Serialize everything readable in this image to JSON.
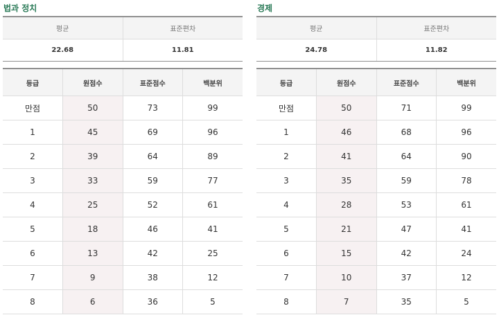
{
  "panels": [
    {
      "title": "법과 정치",
      "stats": {
        "mean_label": "평균",
        "sd_label": "표준편차",
        "mean": "22.68",
        "sd": "11.81"
      },
      "columns": [
        "등급",
        "원점수",
        "표준점수",
        "백분위"
      ],
      "rows": [
        [
          "만점",
          "50",
          "73",
          "99"
        ],
        [
          "1",
          "45",
          "69",
          "96"
        ],
        [
          "2",
          "39",
          "64",
          "89"
        ],
        [
          "3",
          "33",
          "59",
          "77"
        ],
        [
          "4",
          "25",
          "52",
          "61"
        ],
        [
          "5",
          "18",
          "46",
          "41"
        ],
        [
          "6",
          "13",
          "42",
          "25"
        ],
        [
          "7",
          "9",
          "38",
          "12"
        ],
        [
          "8",
          "6",
          "36",
          "5"
        ]
      ]
    },
    {
      "title": "경제",
      "stats": {
        "mean_label": "평균",
        "sd_label": "표준편차",
        "mean": "24.78",
        "sd": "11.82"
      },
      "columns": [
        "등급",
        "원점수",
        "표준점수",
        "백분위"
      ],
      "rows": [
        [
          "만점",
          "50",
          "71",
          "99"
        ],
        [
          "1",
          "46",
          "68",
          "96"
        ],
        [
          "2",
          "41",
          "64",
          "90"
        ],
        [
          "3",
          "35",
          "59",
          "78"
        ],
        [
          "4",
          "28",
          "53",
          "61"
        ],
        [
          "5",
          "21",
          "47",
          "41"
        ],
        [
          "6",
          "15",
          "42",
          "24"
        ],
        [
          "7",
          "10",
          "37",
          "12"
        ],
        [
          "8",
          "7",
          "35",
          "5"
        ]
      ]
    }
  ],
  "colors": {
    "title": "#2a7a57",
    "raw_column_bg": "#f7f1f2",
    "header_bg": "#f4f4f4"
  }
}
